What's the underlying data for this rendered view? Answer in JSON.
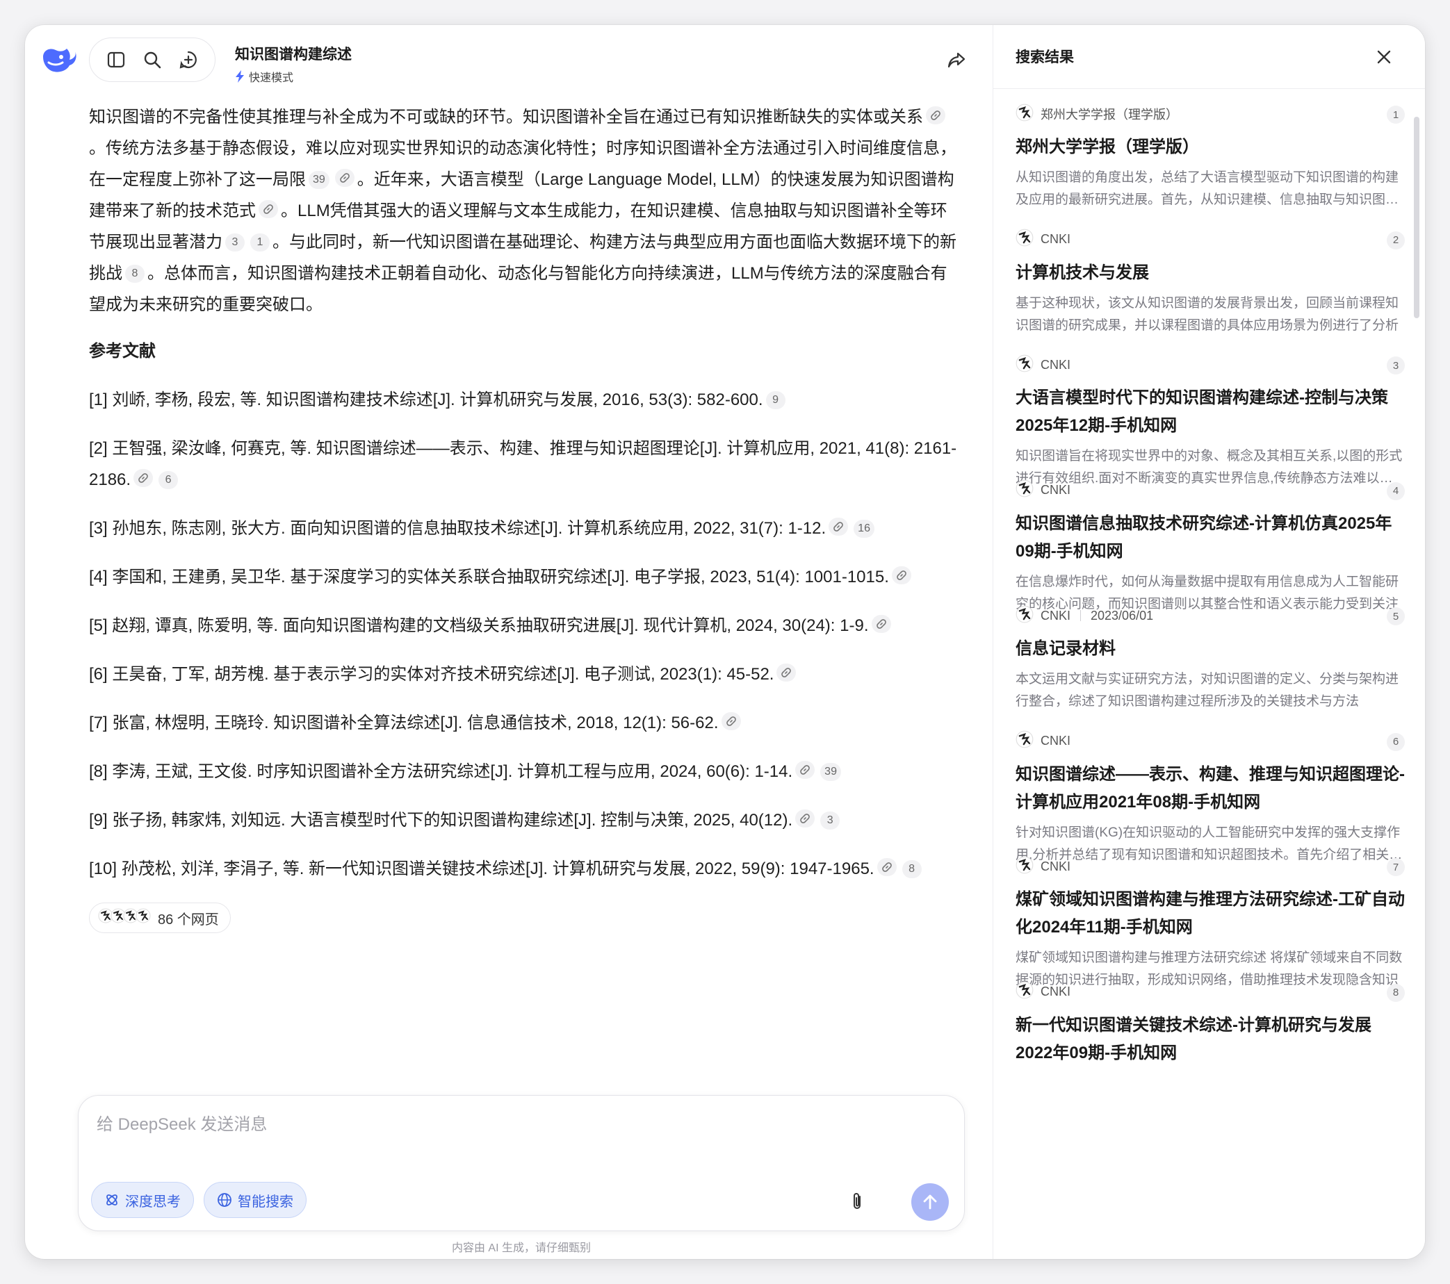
{
  "header": {
    "chat_title": "知识图谱构建综述",
    "mode_label": "快速模式"
  },
  "main": {
    "paragraph_segments": [
      "知识图谱的不完备性使其推理与补全成为不可或缺的环节。知识图谱补全旨在通过已有知识推断缺失的实体或关系",
      "。传统方法多基于静态假设，难以应对现实世界知识的动态演化特性；时序知识图谱补全方法通过引入时间维度信息，在一定程度上弥补了这一局限",
      "。近年来，大语言模型（Large Language Model, LLM）的快速发展为知识图谱构建带来了新的技术范式",
      "。LLM凭借其强大的语义理解与文本生成能力，在知识建模、信息抽取与知识图谱补全等环节展现出显著潜力",
      "。与此同时，新一代知识图谱在基础理论、构建方法与典型应用方面也面临大数据环境下的新挑战",
      "。总体而言，知识图谱构建技术正朝着自动化、动态化与智能化方向持续演进，LLM与传统方法的深度融合有望成为未来研究的重要突破口。"
    ],
    "paragraph_cites": [
      "39",
      "3",
      "1",
      "8"
    ],
    "references_heading": "参考文献",
    "references": [
      {
        "text": "[1] 刘峤, 李杨, 段宏, 等. 知识图谱构建技术综述[J]. 计算机研究与发展, 2016, 53(3): 582-600.",
        "cites": [
          "9"
        ]
      },
      {
        "text": "[2] 王智强, 梁汝峰, 何赛克, 等. 知识图谱综述——表示、构建、推理与知识超图理论[J]. 计算机应用, 2021, 41(8): 2161-2186.",
        "cites": [
          "6"
        ]
      },
      {
        "text": "[3] 孙旭东, 陈志刚, 张大方. 面向知识图谱的信息抽取技术综述[J]. 计算机系统应用, 2022, 31(7): 1-12.",
        "cites": [
          "16"
        ]
      },
      {
        "text": "[4] 李国和, 王建勇, 吴卫华. 基于深度学习的实体关系联合抽取研究综述[J]. 电子学报, 2023, 51(4): 1001-1015.",
        "cites": []
      },
      {
        "text": "[5] 赵翔, 谭真, 陈爱明, 等. 面向知识图谱构建的文档级关系抽取研究进展[J]. 现代计算机, 2024, 30(24): 1-9.",
        "cites": []
      },
      {
        "text": "[6] 王昊奋, 丁军, 胡芳槐. 基于表示学习的实体对齐技术研究综述[J]. 电子测试, 2023(1): 45-52.",
        "cites": []
      },
      {
        "text": "[7] 张富, 林煜明, 王晓玲. 知识图谱补全算法综述[J]. 信息通信技术, 2018, 12(1): 56-62.",
        "cites": []
      },
      {
        "text": "[8] 李涛, 王斌, 王文俊. 时序知识图谱补全方法研究综述[J]. 计算机工程与应用, 2024, 60(6): 1-14.",
        "cites": [
          "39"
        ]
      },
      {
        "text": "[9] 张子扬, 韩家炜, 刘知远. 大语言模型时代下的知识图谱构建综述[J]. 控制与决策, 2025, 40(12).",
        "cites": [
          "3"
        ]
      },
      {
        "text": "[10] 孙茂松, 刘洋, 李涓子, 等. 新一代知识图谱关键技术综述[J]. 计算机研究与发展, 2022, 59(9): 1947-1965.",
        "cites": [
          "8"
        ]
      }
    ],
    "sources_label": "86 个网页"
  },
  "composer": {
    "placeholder": "给 DeepSeek 发送消息",
    "deep_think_label": "深度思考",
    "search_label": "智能搜索",
    "disclaimer": "内容由 AI 生成，请仔细甄别"
  },
  "panel": {
    "title": "搜索结果",
    "results": [
      {
        "source": "郑州大学学报（理学版）",
        "date": "",
        "num": "1",
        "title": "郑州大学学报（理学版）",
        "snippet": "从知识图谱的角度出发，总结了大语言模型驱动下知识图谱的构建及应用的最新研究进展。首先，从知识建模、信息抽取与知识图谱补全等方面进行了梳理"
      },
      {
        "source": "CNKI",
        "date": "",
        "num": "2",
        "title": "计算机技术与发展",
        "snippet": "基于这种现状，该文从知识图谱的发展背景出发，回顾当前课程知识图谱的研究成果，并以课程图谱的具体应用场景为例进行了分析"
      },
      {
        "source": "CNKI",
        "date": "",
        "num": "3",
        "title": "大语言模型时代下的知识图谱构建综述-控制与决策2025年12期-手机知网",
        "snippet": "知识图谱旨在将现实世界中的对象、概念及其相互关系,以图的形式进行有效组织.面对不断演变的真实世界信息,传统静态方法难以应对"
      },
      {
        "source": "CNKI",
        "date": "",
        "num": "4",
        "title": "知识图谱信息抽取技术研究综述-计算机仿真2025年09期-手机知网",
        "snippet": "在信息爆炸时代，如何从海量数据中提取有用信息成为人工智能研究的核心问题，而知识图谱则以其整合性和语义表示能力受到关注"
      },
      {
        "source": "CNKI",
        "date": "2023/06/01",
        "num": "5",
        "title": "信息记录材料",
        "snippet": "本文运用文献与实证研究方法，对知识图谱的定义、分类与架构进行整合，综述了知识图谱构建过程所涉及的关键技术与方法"
      },
      {
        "source": "CNKI",
        "date": "",
        "num": "6",
        "title": "知识图谱综述——表示、构建、推理与知识超图理论-计算机应用2021年08期-手机知网",
        "snippet": "针对知识图谱(KG)在知识驱动的人工智能研究中发挥的强大支撑作用,分析并总结了现有知识图谱和知识超图技术。首先介绍了相关定义"
      },
      {
        "source": "CNKI",
        "date": "",
        "num": "7",
        "title": "煤矿领域知识图谱构建与推理方法研究综述-工矿自动化2024年11期-手机知网",
        "snippet": "煤矿领域知识图谱构建与推理方法研究综述 将煤矿领域来自不同数据源的知识进行抽取，形成知识网络，借助推理技术发现隐含知识"
      },
      {
        "source": "CNKI",
        "date": "",
        "num": "8",
        "title": "新一代知识图谱关键技术综述-计算机研究与发展2022年09期-手机知网",
        "snippet": ""
      }
    ]
  },
  "colors": {
    "accent": "#4d6bfe",
    "chip_bg": "#e8eefc",
    "send_button": "#a9b6f7"
  },
  "icons": {
    "logo": "deepseek-whale-icon",
    "sidebar": "sidebar-toggle-icon",
    "search": "search-icon",
    "new_chat": "new-chat-icon",
    "share": "share-icon",
    "close": "close-icon",
    "attach": "paperclip-icon",
    "send": "arrow-up-icon",
    "link": "link-icon",
    "lightning": "lightning-icon"
  }
}
